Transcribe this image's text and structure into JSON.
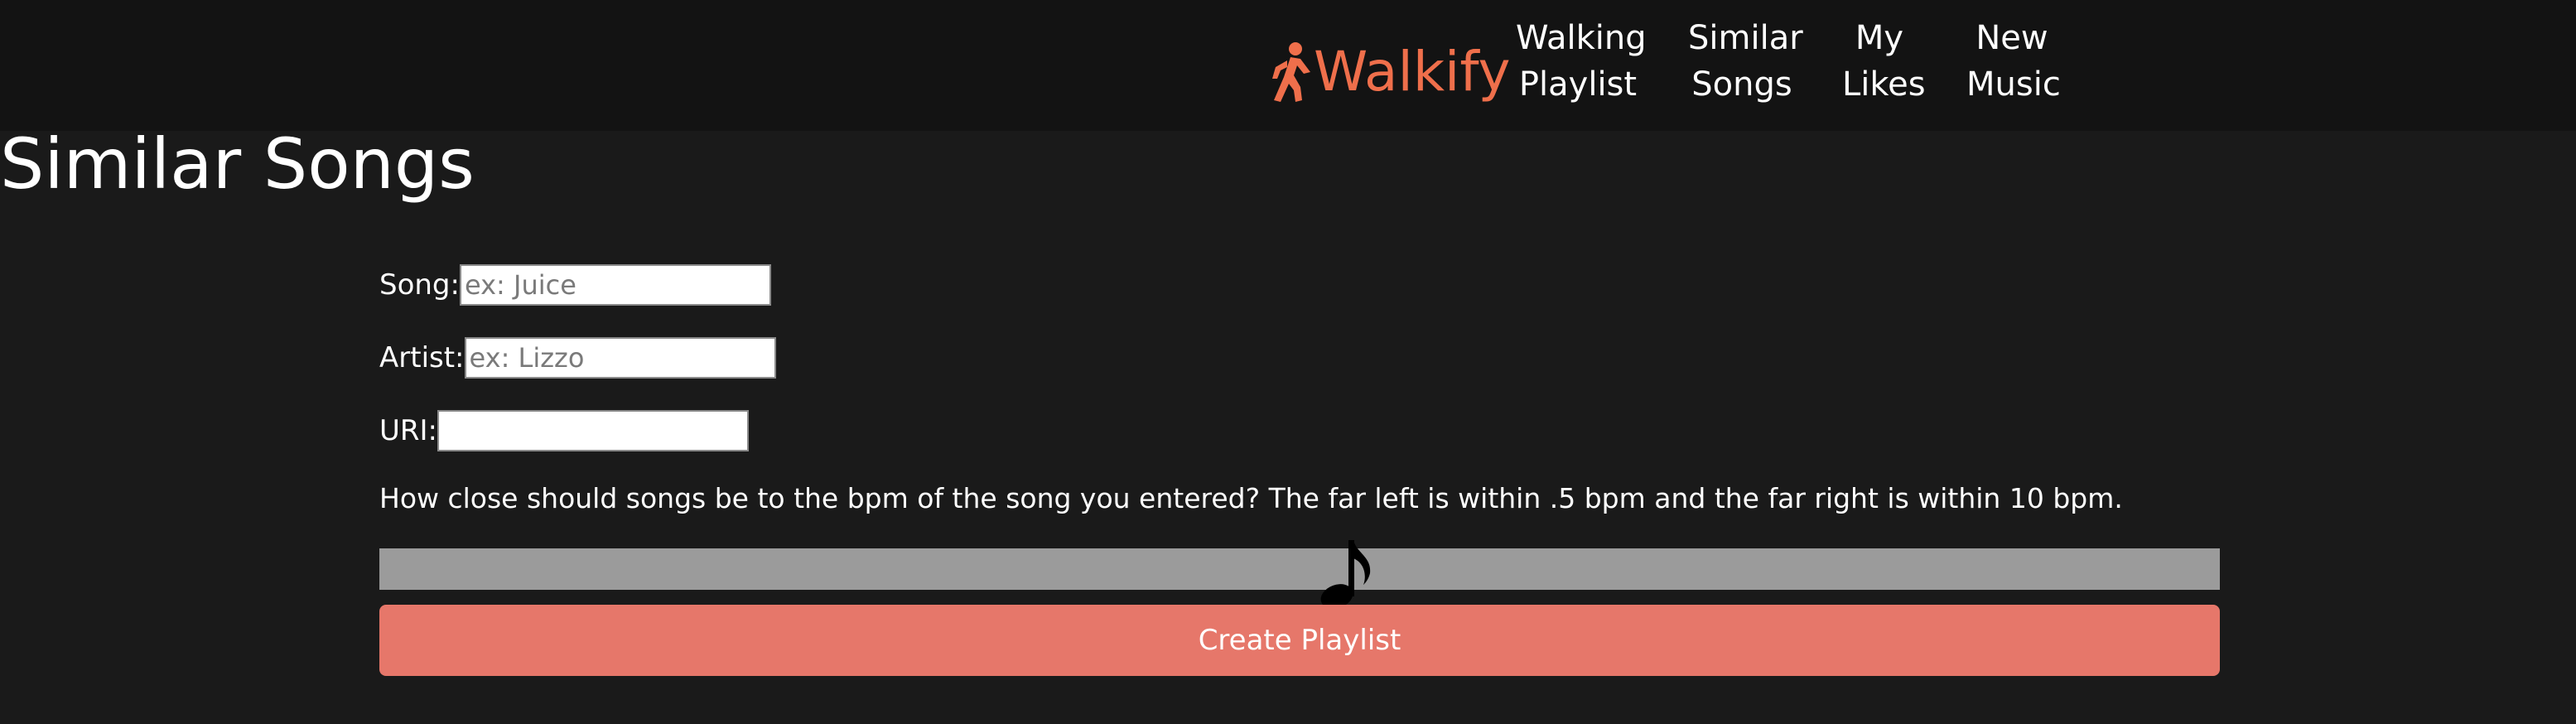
{
  "nav": {
    "brand": "Walkify",
    "brand_icon": "walking-person-icon",
    "brand_color": "#ef6f4b",
    "items": [
      {
        "line1": "Walking",
        "line2": "Playlist"
      },
      {
        "line1": "Similar",
        "line2": "Songs"
      },
      {
        "line1": "My",
        "line2": "Likes"
      },
      {
        "line1": "New",
        "line2": "Music"
      }
    ]
  },
  "page": {
    "title": "Similar Songs"
  },
  "form": {
    "song_label": "Song:",
    "song_placeholder": "ex: Juice",
    "song_value": "",
    "artist_label": "Artist:",
    "artist_placeholder": "ex: Lizzo",
    "artist_value": "",
    "uri_label": "URI:",
    "uri_value": "",
    "question": "How close should songs be to the bpm of the song you entered? The far left is within .5 bpm and the far right is within 10 bpm.",
    "slider_icon": "music-note-icon",
    "slider_fraction": 0.52,
    "submit_label": "Create Playlist",
    "submit_color": "#e6776a"
  }
}
